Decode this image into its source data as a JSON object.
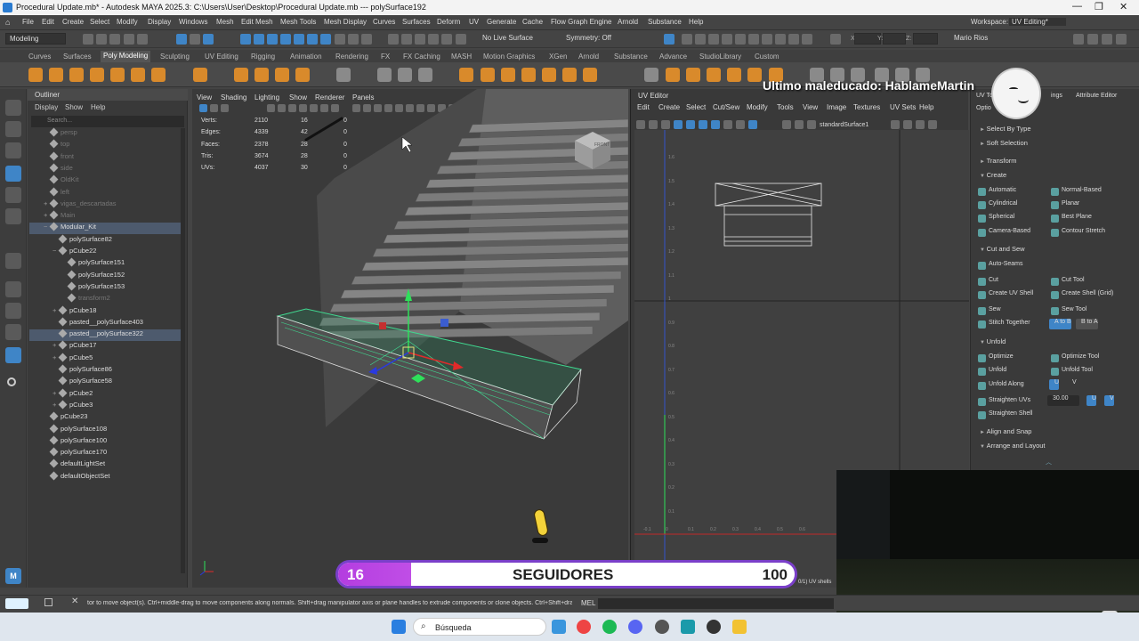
{
  "window": {
    "title": "Procedural Update.mb* - Autodesk MAYA 2025.3: C:\\Users\\User\\Desktop\\Procedural Update.mb   ---   polySurface192"
  },
  "menus": [
    "File",
    "Edit",
    "Create",
    "Select",
    "Modify",
    "Display",
    "Windows",
    "Mesh",
    "Edit Mesh",
    "Mesh Tools",
    "Mesh Display",
    "Curves",
    "Surfaces",
    "Deform",
    "UV",
    "Generate",
    "Cache",
    "Flow Graph Engine",
    "Arnold",
    "Substance",
    "Help"
  ],
  "workspace": {
    "label": "Workspace:",
    "value": "UV Editing*"
  },
  "status": {
    "mode": "Modeling",
    "live": "No Live Surface",
    "symmetry": "Symmetry: Off",
    "user": "Mario Rios",
    "x_label": "X:",
    "y_label": "Y:",
    "z_label": "Z:"
  },
  "shelf_tabs": [
    "Curves",
    "Surfaces",
    "Poly Modeling",
    "Sculpting",
    "UV Editing",
    "Rigging",
    "Animation",
    "Rendering",
    "FX",
    "FX Caching",
    "MASH",
    "Motion Graphics",
    "XGen",
    "Arnold",
    "Substance",
    "Advance",
    "StudioLibrary",
    "Custom"
  ],
  "outliner": {
    "title": "Outliner",
    "menu": [
      "Display",
      "Show",
      "Help"
    ],
    "search": "Search...",
    "items": [
      {
        "label": "persp",
        "indent": 1,
        "dim": true
      },
      {
        "label": "top",
        "indent": 1,
        "dim": true
      },
      {
        "label": "front",
        "indent": 1,
        "dim": true
      },
      {
        "label": "side",
        "indent": 1,
        "dim": true
      },
      {
        "label": "OldKit",
        "indent": 1,
        "dim": true
      },
      {
        "label": "left",
        "indent": 1,
        "dim": true
      },
      {
        "label": "vigas_descartadas",
        "indent": 1,
        "dim": true,
        "exp": "+"
      },
      {
        "label": "Main",
        "indent": 1,
        "dim": true,
        "exp": "+"
      },
      {
        "label": "Modular_Kit",
        "indent": 1,
        "exp": "−",
        "sel": true
      },
      {
        "label": "polySurface82",
        "indent": 2
      },
      {
        "label": "pCube22",
        "indent": 2,
        "exp": "−"
      },
      {
        "label": "polySurface151",
        "indent": 3
      },
      {
        "label": "polySurface152",
        "indent": 3
      },
      {
        "label": "polySurface153",
        "indent": 3
      },
      {
        "label": "transform2",
        "indent": 3,
        "dim": true
      },
      {
        "label": "pCube18",
        "indent": 2,
        "exp": "+"
      },
      {
        "label": "pasted__polySurface403",
        "indent": 2
      },
      {
        "label": "pasted__polySurface322",
        "indent": 2,
        "sel": true
      },
      {
        "label": "pCube17",
        "indent": 2,
        "exp": "+"
      },
      {
        "label": "pCube5",
        "indent": 2,
        "exp": "+"
      },
      {
        "label": "polySurface86",
        "indent": 2
      },
      {
        "label": "polySurface58",
        "indent": 2
      },
      {
        "label": "pCube2",
        "indent": 2,
        "exp": "+"
      },
      {
        "label": "pCube3",
        "indent": 2,
        "exp": "+"
      },
      {
        "label": "pCube23",
        "indent": 1
      },
      {
        "label": "polySurface108",
        "indent": 1
      },
      {
        "label": "polySurface100",
        "indent": 1
      },
      {
        "label": "polySurface170",
        "indent": 1
      },
      {
        "label": "defaultLightSet",
        "indent": 1
      },
      {
        "label": "defaultObjectSet",
        "indent": 1
      }
    ]
  },
  "viewport": {
    "menu": [
      "View",
      "Shading",
      "Lighting",
      "Show",
      "Renderer",
      "Panels"
    ],
    "hud": [
      {
        "label": "Verts:",
        "a": "2110",
        "b": "16",
        "c": "0"
      },
      {
        "label": "Edges:",
        "a": "4339",
        "b": "42",
        "c": "0"
      },
      {
        "label": "Faces:",
        "a": "2378",
        "b": "28",
        "c": "0"
      },
      {
        "label": "Tris:",
        "a": "3674",
        "b": "28",
        "c": "0"
      },
      {
        "label": "UVs:",
        "a": "4037",
        "b": "30",
        "c": "0"
      }
    ],
    "viewcube": "FRONT"
  },
  "uv_editor": {
    "title": "UV Editor",
    "menu": [
      "Edit",
      "Create",
      "Select",
      "Cut/Sew",
      "Modify",
      "Tools",
      "View",
      "Image",
      "Textures",
      "UV Sets",
      "Help"
    ],
    "surface": "standardSurface1",
    "yticks": [
      "1.6",
      "1.5",
      "1.4",
      "1.3",
      "1.2",
      "1.1",
      "1",
      "0.9",
      "0.8",
      "0.7",
      "0.6",
      "0.5",
      "0.4",
      "0.3",
      "0.2",
      "0.1"
    ],
    "xticks": [
      "-0.1",
      "0",
      "0.1",
      "0.2",
      "0.3",
      "0.4",
      "0.5",
      "0.6"
    ],
    "footer": "0/1) UV shells"
  },
  "uv_toolkit": {
    "tab1": "UV To",
    "tab2": "ings",
    "tab3": "Attribute Editor",
    "options": "Optio",
    "select_by_type": "Select By Type",
    "soft_selection": "Soft Selection",
    "transform": "Transform",
    "create": "Create",
    "create_items": [
      "Automatic",
      "Normal-Based",
      "Cylindrical",
      "Planar",
      "Spherical",
      "Best Plane",
      "Camera-Based",
      "Contour Stretch"
    ],
    "cut_and_sew": "Cut and Sew",
    "auto_seams": "Auto-Seams",
    "cut_items": [
      "Cut",
      "Cut Tool",
      "Create UV Shell",
      "Create Shell (Grid)",
      "Sew",
      "Sew Tool",
      "Stitch Together",
      "A to B",
      "B to A"
    ],
    "unfold": "Unfold",
    "unfold_items": [
      "Optimize",
      "Optimize Tool",
      "Unfold",
      "Unfold Tool"
    ],
    "unfold_along": "Unfold Along",
    "u": "U",
    "v": "V",
    "straighten_uvs": "Straighten UVs",
    "straighten_value": "30.00",
    "straighten_shell": "Straighten Shell",
    "align_snap": "Align and Snap",
    "arrange_layout": "Arrange and Layout"
  },
  "overlay": {
    "last_rude": "Ultimo maleducado: HablameMartin"
  },
  "followers": {
    "current": "16",
    "label": "SEGUIDORES",
    "goal": "100",
    "progress": 0.16
  },
  "helpline": {
    "text": "tor to move object(s). Ctrl+middle-drag to move components along normals. Shift+drag manipulator axis or plane handles to extrude components or clone objects. Ctrl+Shift+drag to c",
    "mel": "MEL"
  },
  "taskbar": {
    "search": "Búsqueda"
  },
  "colors": {
    "accent": "#3f85c7",
    "follower_bar": "#b43de0",
    "selection_green": "#40d890"
  }
}
